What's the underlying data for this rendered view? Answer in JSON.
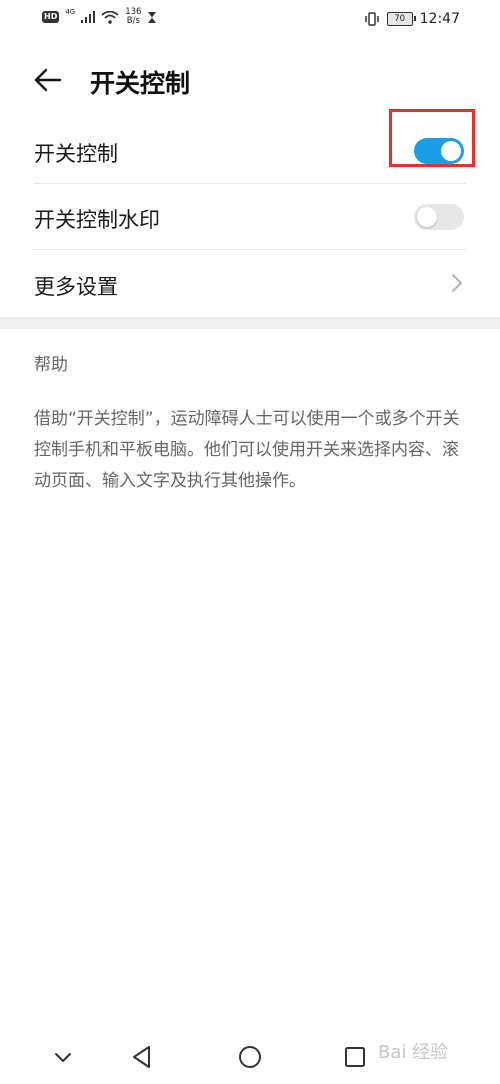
{
  "status_bar": {
    "hd": "HD",
    "network": "4G",
    "speed_value": "136",
    "speed_unit": "B/s",
    "battery": "70",
    "time": "12:47"
  },
  "header": {
    "title": "开关控制"
  },
  "settings": {
    "switch_control": {
      "label": "开关控制",
      "enabled": true
    },
    "switch_watermark": {
      "label": "开关控制水印",
      "enabled": false
    },
    "more_settings": {
      "label": "更多设置"
    }
  },
  "help": {
    "title": "帮助",
    "text": "借助“开关控制”，运动障碍人士可以使用一个或多个开关控制手机和平板电脑。他们可以使用开关来选择内容、滚动页面、输入文字及执行其他操作。"
  },
  "colors": {
    "accent": "#1a9ee9",
    "highlight": "#e53030"
  },
  "watermark": "Bai 经验"
}
